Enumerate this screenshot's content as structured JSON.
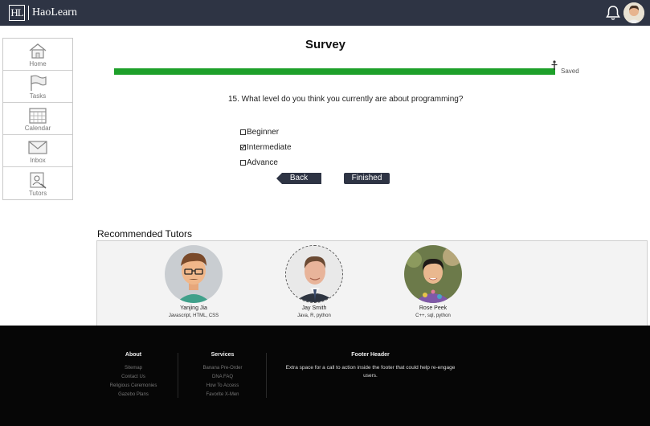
{
  "header": {
    "logo_mark": "HL",
    "logo_text": "HaoLearn"
  },
  "sidebar": {
    "items": [
      {
        "label": "Home",
        "icon": "home-icon"
      },
      {
        "label": "Tasks",
        "icon": "flag-icon"
      },
      {
        "label": "Calendar",
        "icon": "calendar-icon"
      },
      {
        "label": "Inbox",
        "icon": "mail-icon"
      },
      {
        "label": "Tutors",
        "icon": "tutor-icon"
      }
    ]
  },
  "survey": {
    "title": "Survey",
    "progress_fraction": 1.0,
    "saved_label": "Saved",
    "question": "15. What level do you think you currently are about programming?",
    "options": [
      {
        "label": "Beginner",
        "checked": false
      },
      {
        "label": "Intermediate",
        "checked": true
      },
      {
        "label": "Advance",
        "checked": false
      }
    ],
    "back_label": "Back",
    "finished_label": "Finished"
  },
  "tutors": {
    "title": "Recommended Tutors",
    "items": [
      {
        "name": "Yanjing Jia",
        "skills": "Javascript, HTML, CSS"
      },
      {
        "name": "Jay Smith",
        "skills": "Java, R, python"
      },
      {
        "name": "Rose Peek",
        "skills": "C++, sql, python"
      }
    ]
  },
  "footer": {
    "about": {
      "heading": "About",
      "links": [
        "Sitemap",
        "Contact Us",
        "Religious Ceremonies",
        "Gazebo Plans"
      ]
    },
    "services": {
      "heading": "Services",
      "links": [
        "Banana Pre-Order",
        "DNA FAQ",
        "How To Access",
        "Favorite X-Men"
      ]
    },
    "cta": {
      "heading": "Footer Header",
      "text": "Extra space for a call to action inside the footer that could help re-engage users."
    }
  },
  "colors": {
    "header_bg": "#2e3444",
    "progress_green": "#1ea02a",
    "footer_bg": "#060606"
  }
}
